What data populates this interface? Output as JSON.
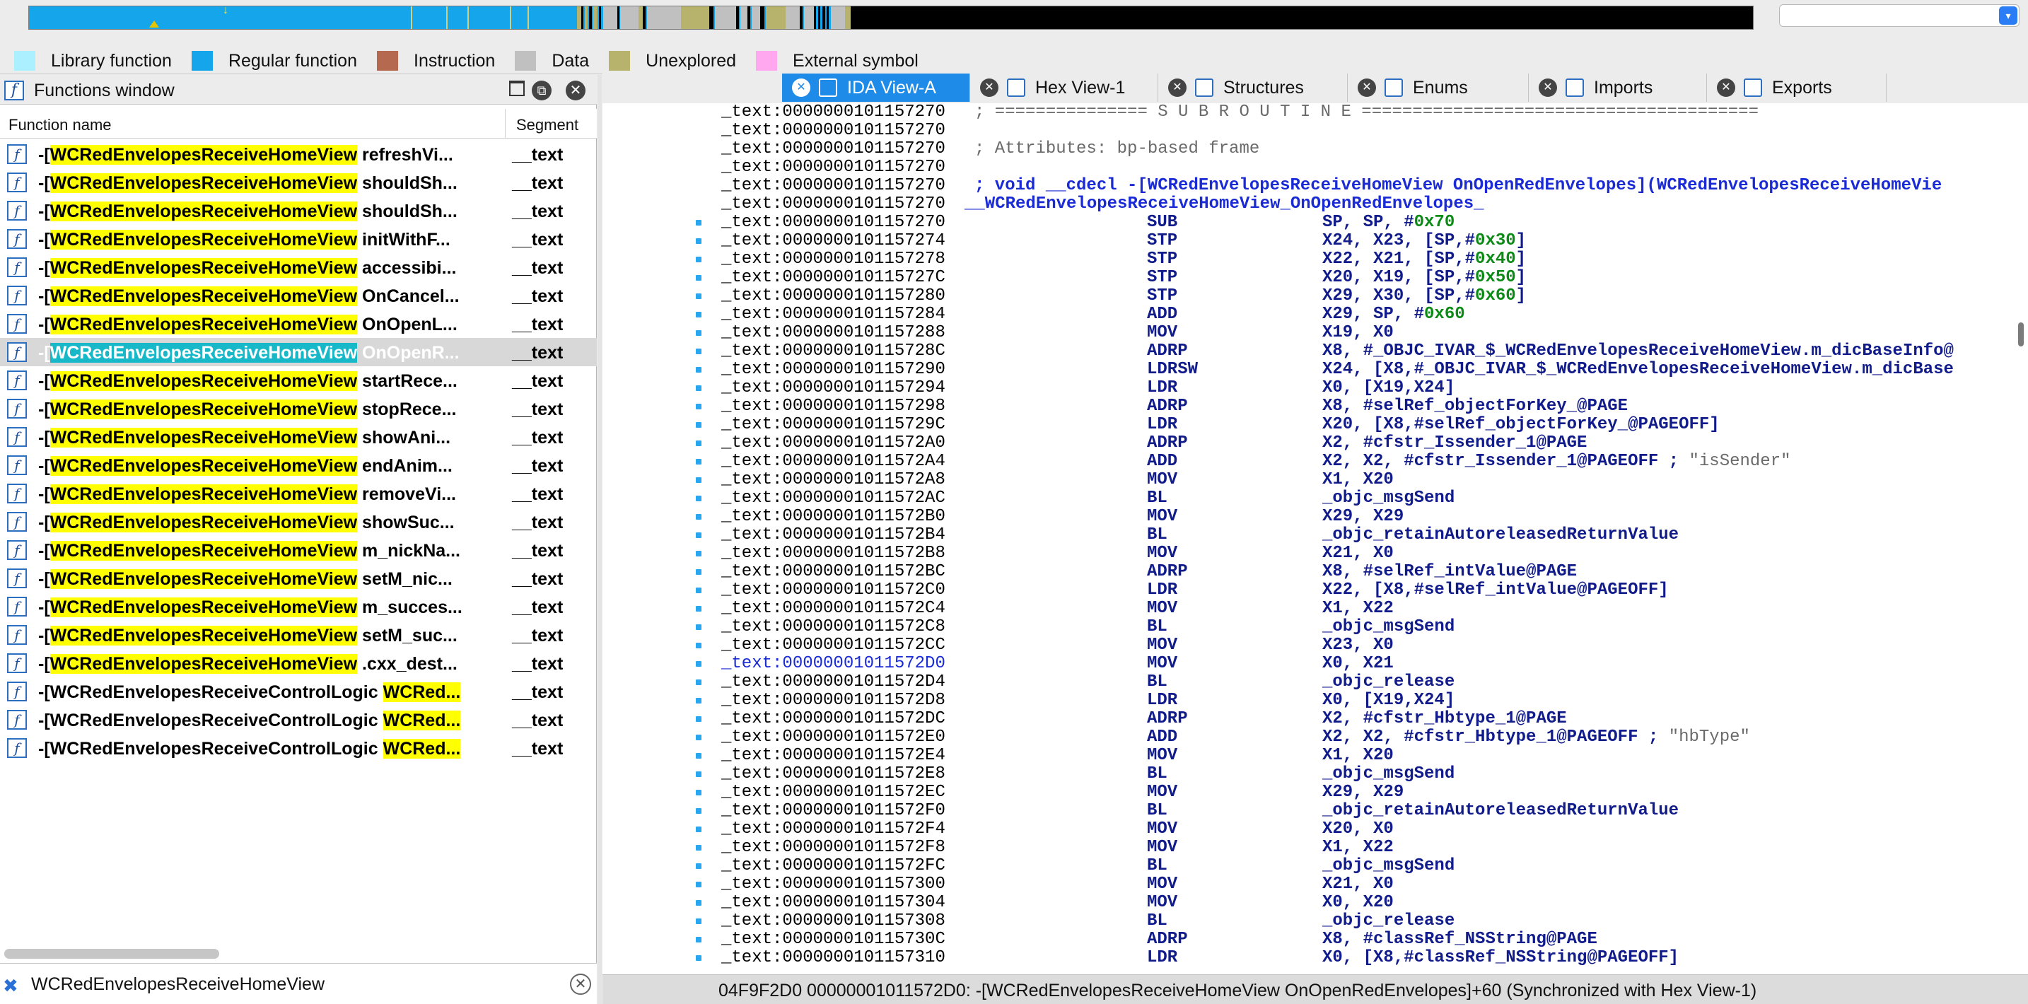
{
  "legend": [
    {
      "label": "Library function",
      "color": "#aaf0ff"
    },
    {
      "label": "Regular function",
      "color": "#14a5ea"
    },
    {
      "label": "Instruction",
      "color": "#b56a50"
    },
    {
      "label": "Data",
      "color": "#c0c0c0"
    },
    {
      "label": "Unexplored",
      "color": "#b8b36c"
    },
    {
      "label": "External symbol",
      "color": "#ffa8f0"
    }
  ],
  "functions_window": {
    "title": "Functions window",
    "col_name": "Function name",
    "col_segment": "Segment",
    "rows": [
      {
        "prefix": "-[",
        "cls": "WCRedEnvelopesReceiveHomeView",
        "method": "refreshVi...",
        "seg": "__text",
        "hl_cls": true,
        "selected": false
      },
      {
        "prefix": "-[",
        "cls": "WCRedEnvelopesReceiveHomeView",
        "method": "shouldSh...",
        "seg": "__text",
        "hl_cls": true,
        "selected": false
      },
      {
        "prefix": "-[",
        "cls": "WCRedEnvelopesReceiveHomeView",
        "method": "shouldSh...",
        "seg": "__text",
        "hl_cls": true,
        "selected": false
      },
      {
        "prefix": "-[",
        "cls": "WCRedEnvelopesReceiveHomeView",
        "method": "initWithF...",
        "seg": "__text",
        "hl_cls": true,
        "selected": false
      },
      {
        "prefix": "-[",
        "cls": "WCRedEnvelopesReceiveHomeView",
        "method": "accessibi...",
        "seg": "__text",
        "hl_cls": true,
        "selected": false
      },
      {
        "prefix": "-[",
        "cls": "WCRedEnvelopesReceiveHomeView",
        "method": "OnCancel...",
        "seg": "__text",
        "hl_cls": true,
        "selected": false
      },
      {
        "prefix": "-[",
        "cls": "WCRedEnvelopesReceiveHomeView",
        "method": "OnOpenL...",
        "seg": "__text",
        "hl_cls": true,
        "selected": false
      },
      {
        "prefix": "-[",
        "cls": "WCRedEnvelopesReceiveHomeView",
        "method": "OnOpenR...",
        "seg": "__text",
        "hl_cls": true,
        "selected": true
      },
      {
        "prefix": "-[",
        "cls": "WCRedEnvelopesReceiveHomeView",
        "method": "startRece...",
        "seg": "__text",
        "hl_cls": true,
        "selected": false
      },
      {
        "prefix": "-[",
        "cls": "WCRedEnvelopesReceiveHomeView",
        "method": "stopRece...",
        "seg": "__text",
        "hl_cls": true,
        "selected": false
      },
      {
        "prefix": "-[",
        "cls": "WCRedEnvelopesReceiveHomeView",
        "method": "showAni...",
        "seg": "__text",
        "hl_cls": true,
        "selected": false
      },
      {
        "prefix": "-[",
        "cls": "WCRedEnvelopesReceiveHomeView",
        "method": "endAnim...",
        "seg": "__text",
        "hl_cls": true,
        "selected": false
      },
      {
        "prefix": "-[",
        "cls": "WCRedEnvelopesReceiveHomeView",
        "method": "removeVi...",
        "seg": "__text",
        "hl_cls": true,
        "selected": false
      },
      {
        "prefix": "-[",
        "cls": "WCRedEnvelopesReceiveHomeView",
        "method": "showSuc...",
        "seg": "__text",
        "hl_cls": true,
        "selected": false
      },
      {
        "prefix": "-[",
        "cls": "WCRedEnvelopesReceiveHomeView",
        "method": "m_nickNa...",
        "seg": "__text",
        "hl_cls": true,
        "selected": false
      },
      {
        "prefix": "-[",
        "cls": "WCRedEnvelopesReceiveHomeView",
        "method": "setM_nic...",
        "seg": "__text",
        "hl_cls": true,
        "selected": false
      },
      {
        "prefix": "-[",
        "cls": "WCRedEnvelopesReceiveHomeView",
        "method": "m_succes...",
        "seg": "__text",
        "hl_cls": true,
        "selected": false
      },
      {
        "prefix": "-[",
        "cls": "WCRedEnvelopesReceiveHomeView",
        "method": "setM_suc...",
        "seg": "__text",
        "hl_cls": true,
        "selected": false
      },
      {
        "prefix": "-[",
        "cls": "WCRedEnvelopesReceiveHomeView",
        "method": ".cxx_dest...",
        "seg": "__text",
        "hl_cls": true,
        "selected": false
      },
      {
        "prefix": "-[",
        "cls": "WCRedEnvelopesReceiveControlLogic",
        "method": "WCRed...",
        "seg": "__text",
        "hl_cls": false,
        "selected": false
      },
      {
        "prefix": "-[",
        "cls": "WCRedEnvelopesReceiveControlLogic",
        "method": "WCRed...",
        "seg": "__text",
        "hl_cls": false,
        "selected": false
      },
      {
        "prefix": "-[",
        "cls": "WCRedEnvelopesReceiveControlLogic",
        "method": "WCRed...",
        "seg": "__text",
        "hl_cls": false,
        "selected": false
      }
    ],
    "search_value": "WCRedEnvelopesReceiveHomeView"
  },
  "tabs": [
    {
      "label": "IDA View-A",
      "active": true
    },
    {
      "label": "Hex View-1",
      "active": false
    },
    {
      "label": "Structures",
      "active": false
    },
    {
      "label": "Enums",
      "active": false
    },
    {
      "label": "Imports",
      "active": false
    },
    {
      "label": "Exports",
      "active": false
    }
  ],
  "asm_lines": [
    {
      "addr": "_text:0000000101157270",
      "type": "cmt",
      "text": "; =============== S U B R O U T I N E ======================================="
    },
    {
      "addr": "_text:0000000101157270",
      "type": "empty"
    },
    {
      "addr": "_text:0000000101157270",
      "type": "cmt",
      "text": "; Attributes: bp-based frame"
    },
    {
      "addr": "_text:0000000101157270",
      "type": "empty"
    },
    {
      "addr": "_text:0000000101157270",
      "type": "func",
      "text": "; void __cdecl -[WCRedEnvelopesReceiveHomeView OnOpenRedEnvelopes](WCRedEnvelopesReceiveHomeVie"
    },
    {
      "addr": "_text:0000000101157270",
      "type": "label",
      "text": "__WCRedEnvelopesReceiveHomeView_OnOpenRedEnvelopes_"
    },
    {
      "addr": "_text:0000000101157270",
      "type": "ins",
      "mn": "SUB",
      "ops": "SP, SP, #",
      "num": "0x70",
      "dot": true
    },
    {
      "addr": "_text:0000000101157274",
      "type": "ins",
      "mn": "STP",
      "ops": "X24, X23, [SP,#",
      "num": "0x30",
      "tail": "]",
      "dot": true
    },
    {
      "addr": "_text:0000000101157278",
      "type": "ins",
      "mn": "STP",
      "ops": "X22, X21, [SP,#",
      "num": "0x40",
      "tail": "]",
      "dot": true
    },
    {
      "addr": "_text:000000010115727C",
      "type": "ins",
      "mn": "STP",
      "ops": "X20, X19, [SP,#",
      "num": "0x50",
      "tail": "]",
      "dot": true
    },
    {
      "addr": "_text:0000000101157280",
      "type": "ins",
      "mn": "STP",
      "ops": "X29, X30, [SP,#",
      "num": "0x60",
      "tail": "]",
      "dot": true
    },
    {
      "addr": "_text:0000000101157284",
      "type": "ins",
      "mn": "ADD",
      "ops": "X29, SP, #",
      "num": "0x60",
      "dot": true
    },
    {
      "addr": "_text:0000000101157288",
      "type": "ins",
      "mn": "MOV",
      "ops": "X19, X0",
      "dot": true
    },
    {
      "addr": "_text:000000010115728C",
      "type": "ins",
      "mn": "ADRP",
      "ops": "X8, #_OBJC_IVAR_$_WCRedEnvelopesReceiveHomeView.m_dicBaseInfo@",
      "dot": true
    },
    {
      "addr": "_text:0000000101157290",
      "type": "ins",
      "mn": "LDRSW",
      "ops": "X24, [X8,#_OBJC_IVAR_$_WCRedEnvelopesReceiveHomeView.m_dicBase",
      "dot": true
    },
    {
      "addr": "_text:0000000101157294",
      "type": "ins",
      "mn": "LDR",
      "ops": "X0, [X19,X24]",
      "dot": true
    },
    {
      "addr": "_text:0000000101157298",
      "type": "ins",
      "mn": "ADRP",
      "ops": "X8, #selRef_objectForKey_@PAGE",
      "dot": true
    },
    {
      "addr": "_text:000000010115729C",
      "type": "ins",
      "mn": "LDR",
      "ops": "X20, [X8,#selRef_objectForKey_@PAGEOFF]",
      "dot": true
    },
    {
      "addr": "_text:00000001011572A0",
      "type": "ins",
      "mn": "ADRP",
      "ops": "X2, #cfstr_Issender_1@PAGE",
      "dot": true
    },
    {
      "addr": "_text:00000001011572A4",
      "type": "ins",
      "mn": "ADD",
      "ops": "X2, X2, #cfstr_Issender_1@PAGEOFF ; ",
      "str": "\"isSender\"",
      "dot": true
    },
    {
      "addr": "_text:00000001011572A8",
      "type": "ins",
      "mn": "MOV",
      "ops": "X1, X20",
      "dot": true
    },
    {
      "addr": "_text:00000001011572AC",
      "type": "ins",
      "mn": "BL",
      "ops": "_objc_msgSend",
      "dot": true
    },
    {
      "addr": "_text:00000001011572B0",
      "type": "ins",
      "mn": "MOV",
      "ops": "X29, X29",
      "dot": true
    },
    {
      "addr": "_text:00000001011572B4",
      "type": "ins",
      "mn": "BL",
      "ops": "_objc_retainAutoreleasedReturnValue",
      "dot": true
    },
    {
      "addr": "_text:00000001011572B8",
      "type": "ins",
      "mn": "MOV",
      "ops": "X21, X0",
      "dot": true
    },
    {
      "addr": "_text:00000001011572BC",
      "type": "ins",
      "mn": "ADRP",
      "ops": "X8, #selRef_intValue@PAGE",
      "dot": true
    },
    {
      "addr": "_text:00000001011572C0",
      "type": "ins",
      "mn": "LDR",
      "ops": "X22, [X8,#selRef_intValue@PAGEOFF]",
      "dot": true
    },
    {
      "addr": "_text:00000001011572C4",
      "type": "ins",
      "mn": "MOV",
      "ops": "X1, X22",
      "dot": true
    },
    {
      "addr": "_text:00000001011572C8",
      "type": "ins",
      "mn": "BL",
      "ops": "_objc_msgSend",
      "dot": true
    },
    {
      "addr": "_text:00000001011572CC",
      "type": "ins",
      "mn": "MOV",
      "ops": "X23, X0",
      "dot": true
    },
    {
      "addr": "_text:00000001011572D0",
      "type": "ins",
      "mn": "MOV",
      "ops": "X0, X21",
      "dot": true,
      "cur": true
    },
    {
      "addr": "_text:00000001011572D4",
      "type": "ins",
      "mn": "BL",
      "ops": "_objc_release",
      "dot": true
    },
    {
      "addr": "_text:00000001011572D8",
      "type": "ins",
      "mn": "LDR",
      "ops": "X0, [X19,X24]",
      "dot": true
    },
    {
      "addr": "_text:00000001011572DC",
      "type": "ins",
      "mn": "ADRP",
      "ops": "X2, #cfstr_Hbtype_1@PAGE",
      "dot": true
    },
    {
      "addr": "_text:00000001011572E0",
      "type": "ins",
      "mn": "ADD",
      "ops": "X2, X2, #cfstr_Hbtype_1@PAGEOFF ; ",
      "str": "\"hbType\"",
      "dot": true
    },
    {
      "addr": "_text:00000001011572E4",
      "type": "ins",
      "mn": "MOV",
      "ops": "X1, X20",
      "dot": true
    },
    {
      "addr": "_text:00000001011572E8",
      "type": "ins",
      "mn": "BL",
      "ops": "_objc_msgSend",
      "dot": true
    },
    {
      "addr": "_text:00000001011572EC",
      "type": "ins",
      "mn": "MOV",
      "ops": "X29, X29",
      "dot": true
    },
    {
      "addr": "_text:00000001011572F0",
      "type": "ins",
      "mn": "BL",
      "ops": "_objc_retainAutoreleasedReturnValue",
      "dot": true
    },
    {
      "addr": "_text:00000001011572F4",
      "type": "ins",
      "mn": "MOV",
      "ops": "X20, X0",
      "dot": true
    },
    {
      "addr": "_text:00000001011572F8",
      "type": "ins",
      "mn": "MOV",
      "ops": "X1, X22",
      "dot": true
    },
    {
      "addr": "_text:00000001011572FC",
      "type": "ins",
      "mn": "BL",
      "ops": "_objc_msgSend",
      "dot": true
    },
    {
      "addr": "_text:0000000101157300",
      "type": "ins",
      "mn": "MOV",
      "ops": "X21, X0",
      "dot": true
    },
    {
      "addr": "_text:0000000101157304",
      "type": "ins",
      "mn": "MOV",
      "ops": "X0, X20",
      "dot": true
    },
    {
      "addr": "_text:0000000101157308",
      "type": "ins",
      "mn": "BL",
      "ops": "_objc_release",
      "dot": true
    },
    {
      "addr": "_text:000000010115730C",
      "type": "ins",
      "mn": "ADRP",
      "ops": "X8, #classRef_NSString@PAGE",
      "dot": true
    },
    {
      "addr": "_text:0000000101157310",
      "type": "ins",
      "mn": "LDR",
      "ops": "X0, [X8,#classRef_NSString@PAGEOFF]",
      "dot": true
    }
  ],
  "status": "04F9F2D0 00000001011572D0: -[WCRedEnvelopesReceiveHomeView OnOpenRedEnvelopes]+60 (Synchronized with Hex View-1)",
  "colors": {
    "regular_function": "#14a5ea",
    "data": "#c0c0c0",
    "unexplored": "#b8b36c",
    "highlight": "#ffff00",
    "active_tab": "#1e8be8"
  }
}
